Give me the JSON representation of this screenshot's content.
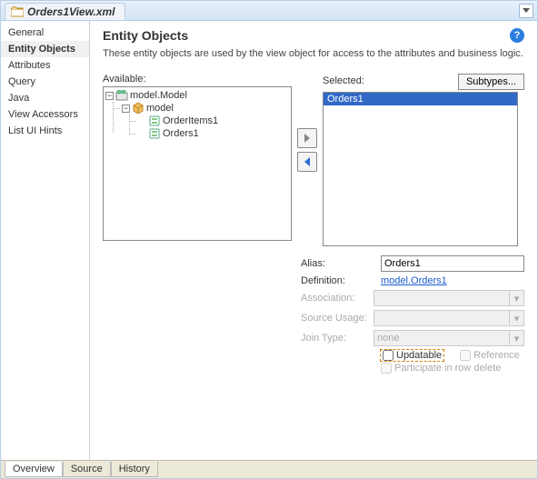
{
  "title": "Orders1View.xml",
  "sidebar": {
    "items": [
      {
        "label": "General"
      },
      {
        "label": "Entity Objects"
      },
      {
        "label": "Attributes"
      },
      {
        "label": "Query"
      },
      {
        "label": "Java"
      },
      {
        "label": "View Accessors"
      },
      {
        "label": "List UI Hints"
      }
    ],
    "active": "Entity Objects"
  },
  "main": {
    "heading": "Entity Objects",
    "description": "These entity objects are used by the view object for access to the attributes and business logic.",
    "available_label": "Available:",
    "selected_label": "Selected:",
    "subtypes_label": "Subtypes...",
    "tree": {
      "root": "model.Model",
      "pkg": "model",
      "items": [
        "OrderItems1",
        "Orders1"
      ]
    },
    "selected_items": [
      "Orders1"
    ]
  },
  "form": {
    "alias_label": "Alias:",
    "alias_value": "Orders1",
    "definition_label": "Definition:",
    "definition_value": "model.Orders1",
    "association_label": "Association:",
    "association_value": "",
    "source_usage_label": "Source Usage:",
    "source_usage_value": "",
    "join_type_label": "Join Type:",
    "join_type_value": "none",
    "updatable_label": "Updatable",
    "reference_label": "Reference",
    "participate_label": "Participate in row delete"
  },
  "bottom_tabs": [
    "Overview",
    "Source",
    "History"
  ]
}
